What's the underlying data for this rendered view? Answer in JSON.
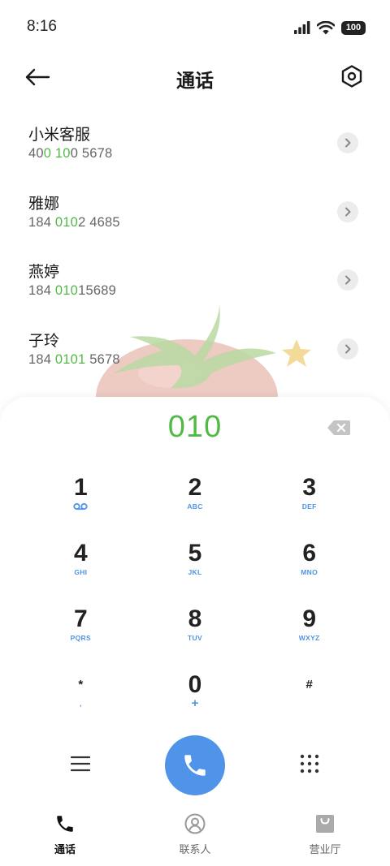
{
  "status_bar": {
    "time": "8:16",
    "battery": "100",
    "icons": [
      "signal-icon",
      "wifi-icon",
      "battery-icon"
    ]
  },
  "header": {
    "title": "通话",
    "back_icon": "arrow-left-icon",
    "settings_icon": "hexagon-settings-icon"
  },
  "contacts": [
    {
      "name": "小米客服",
      "number_parts": [
        "40",
        "0 10",
        "0 5678"
      ]
    },
    {
      "name": "雅娜",
      "number_parts": [
        "184 ",
        "010",
        "2 4685"
      ]
    },
    {
      "name": "燕婷",
      "number_parts": [
        "184 ",
        "010",
        "15689"
      ]
    },
    {
      "name": "子玲",
      "number_parts": [
        "184 ",
        "0101",
        " 5678"
      ]
    }
  ],
  "dialer": {
    "input": "010",
    "keys": [
      {
        "digit": "1",
        "letters": ""
      },
      {
        "digit": "2",
        "letters": "ABC"
      },
      {
        "digit": "3",
        "letters": "DEF"
      },
      {
        "digit": "4",
        "letters": "GHI"
      },
      {
        "digit": "5",
        "letters": "JKL"
      },
      {
        "digit": "6",
        "letters": "MNO"
      },
      {
        "digit": "7",
        "letters": "PQRS"
      },
      {
        "digit": "8",
        "letters": "TUV"
      },
      {
        "digit": "9",
        "letters": "WXYZ"
      },
      {
        "digit": "*",
        "letters": ","
      },
      {
        "digit": "0",
        "letters": "+"
      },
      {
        "digit": "#",
        "letters": ""
      }
    ]
  },
  "bottom_nav": {
    "items": [
      {
        "label": "通话",
        "icon": "phone-icon",
        "active": true
      },
      {
        "label": "联系人",
        "icon": "contact-icon",
        "active": false
      },
      {
        "label": "营业厅",
        "icon": "shopping-bag-icon",
        "active": false
      }
    ]
  },
  "colors": {
    "accent_green": "#52b947",
    "accent_blue": "#4f94e8",
    "text_primary": "#1a1a1a",
    "text_secondary": "#666666"
  }
}
